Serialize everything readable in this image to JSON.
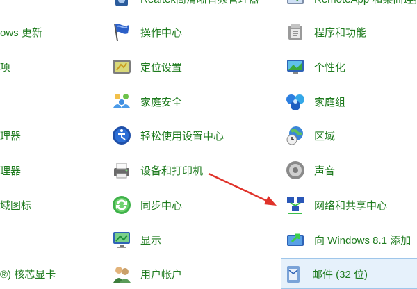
{
  "col0": [
    {
      "label": "ows 更新"
    },
    {
      "label": "项"
    },
    {
      "label": "理器"
    },
    {
      "label": "理器"
    },
    {
      "label": "域图标"
    },
    {
      "label": "®) 核芯显卡"
    }
  ],
  "col1": [
    {
      "label": "Realtek高清晰音频管理器",
      "icon": "speaker-icon"
    },
    {
      "label": "操作中心",
      "icon": "flag-icon"
    },
    {
      "label": "定位设置",
      "icon": "gps-device-icon"
    },
    {
      "label": "家庭安全",
      "icon": "family-safety-icon"
    },
    {
      "label": "轻松使用设置中心",
      "icon": "ease-of-access-icon"
    },
    {
      "label": "设备和打印机",
      "icon": "printer-icon"
    },
    {
      "label": "同步中心",
      "icon": "sync-icon"
    },
    {
      "label": "显示",
      "icon": "monitor-icon"
    },
    {
      "label": "用户帐户",
      "icon": "users-icon"
    }
  ],
  "col2": [
    {
      "label": "RemoteApp 和桌面连接",
      "icon": "remoteapp-icon"
    },
    {
      "label": "程序和功能",
      "icon": "programs-icon"
    },
    {
      "label": "个性化",
      "icon": "personalization-icon"
    },
    {
      "label": "家庭组",
      "icon": "homegroup-icon"
    },
    {
      "label": "区域",
      "icon": "globe-clock-icon"
    },
    {
      "label": "声音",
      "icon": "sound-icon"
    },
    {
      "label": "网络和共享中心",
      "icon": "network-icon"
    },
    {
      "label": "向 Windows 8.1 添加",
      "icon": "add-features-icon"
    },
    {
      "label": "邮件 (32 位)",
      "icon": "mail-icon"
    }
  ],
  "colors": {
    "label": "#1e7b1e",
    "arrow": "#e0322a",
    "selected_bg": "#e6f1fb"
  }
}
